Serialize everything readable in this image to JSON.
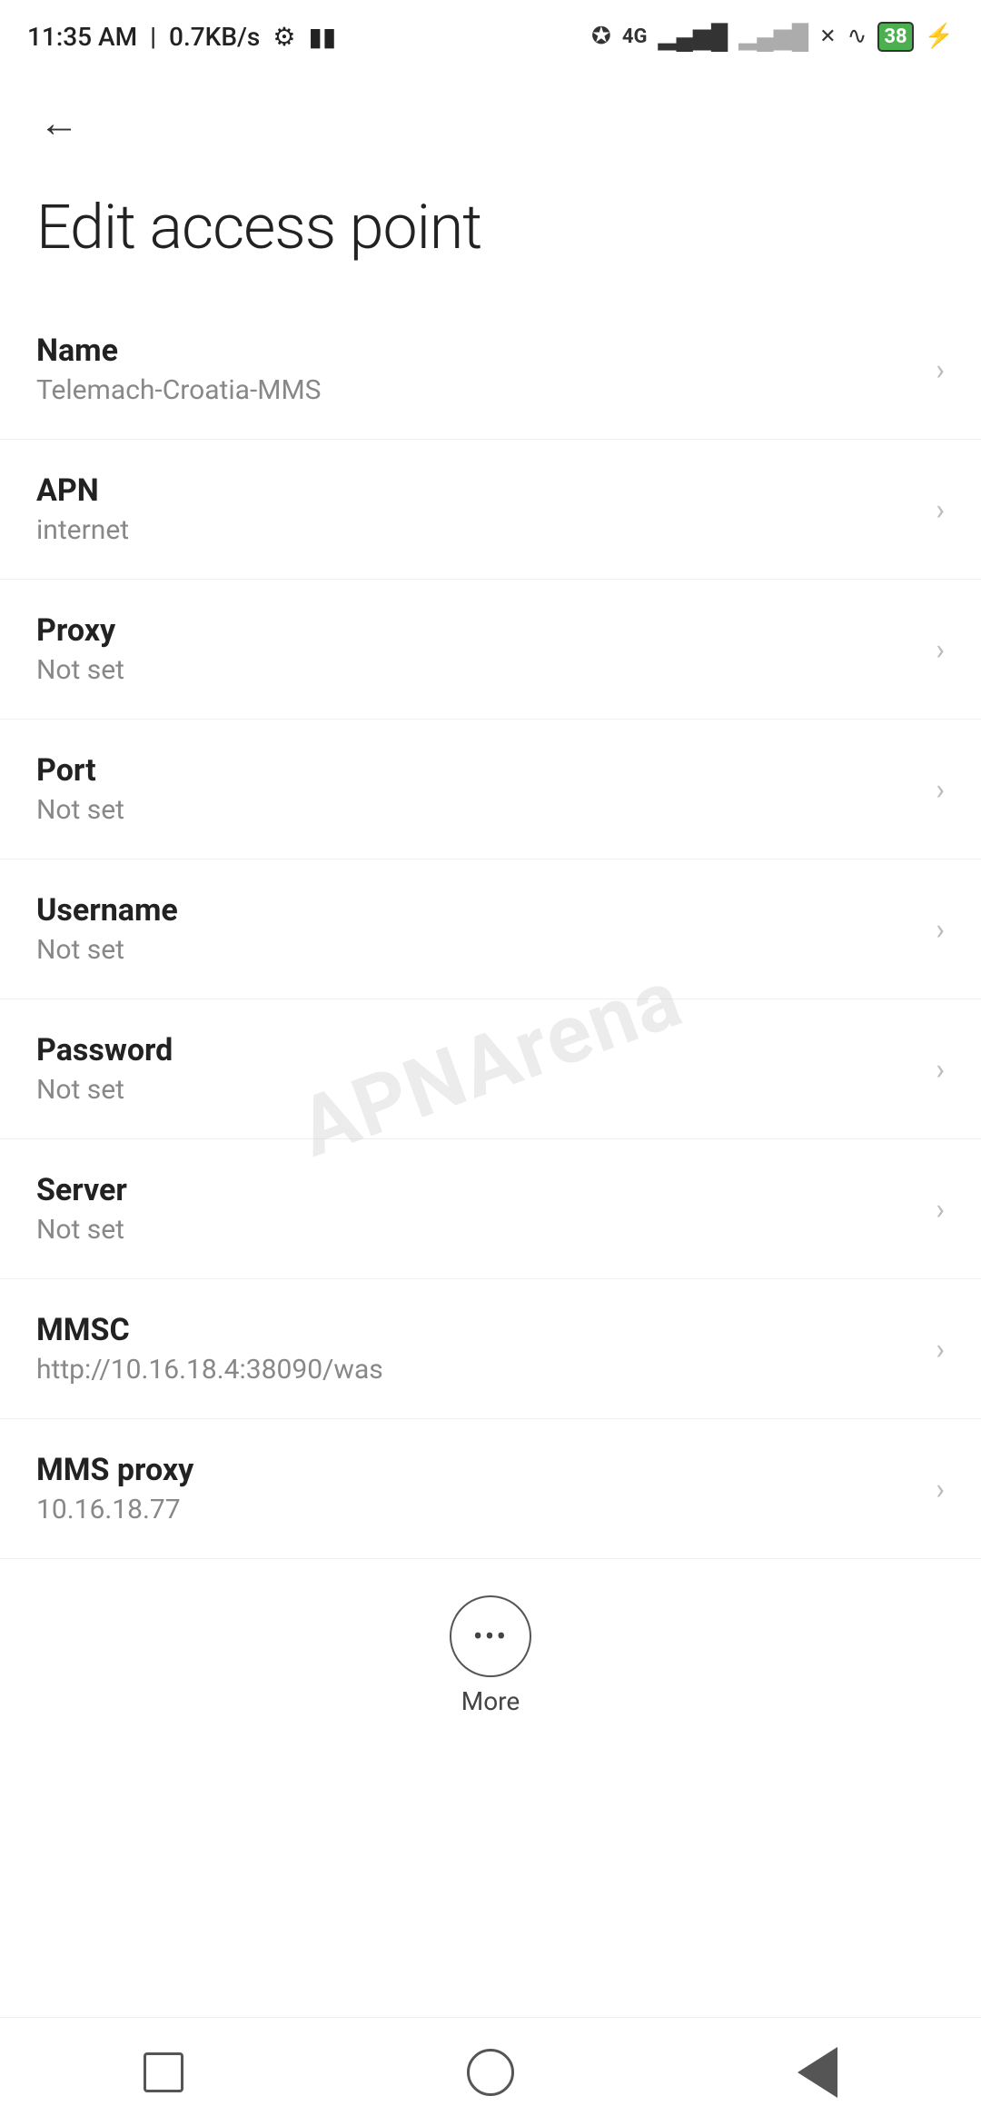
{
  "statusBar": {
    "time": "11:35 AM",
    "speed": "0.7KB/s"
  },
  "toolbar": {
    "backLabel": "←"
  },
  "page": {
    "title": "Edit access point"
  },
  "listItems": [
    {
      "label": "Name",
      "value": "Telemach-Croatia-MMS"
    },
    {
      "label": "APN",
      "value": "internet"
    },
    {
      "label": "Proxy",
      "value": "Not set"
    },
    {
      "label": "Port",
      "value": "Not set"
    },
    {
      "label": "Username",
      "value": "Not set"
    },
    {
      "label": "Password",
      "value": "Not set"
    },
    {
      "label": "Server",
      "value": "Not set"
    },
    {
      "label": "MMSC",
      "value": "http://10.16.18.4:38090/was"
    },
    {
      "label": "MMS proxy",
      "value": "10.16.18.77"
    }
  ],
  "more": {
    "label": "More"
  },
  "watermark": "APNArena"
}
